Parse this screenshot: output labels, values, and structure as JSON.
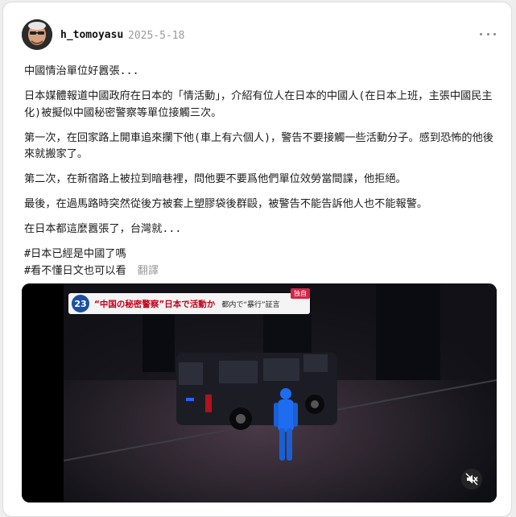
{
  "post": {
    "username": "h_tomoyasu",
    "date": "2025-5-18",
    "paragraphs": [
      "中國情治單位好囂張...",
      "日本媒體報道中國政府在日本的「情活動」，介紹有位人在日本的中國人(在日本上班，主張中國民主化)被擬似中國秘密警察等單位接觸三次。",
      "第一次，在回家路上開車追來攔下他(車上有六個人)，警告不要接觸一些活動分子。感到恐怖的他後來就搬家了。",
      "第二次，在新宿路上被拉到暗巷裡，問他要不要爲他們單位效勞當間諜，他拒絕。",
      "最後，在過馬路時突然從後方被套上塑膠袋後群毆，被警告不能告訴他人也不能報警。",
      "在日本都這麼囂張了，台灣就..."
    ],
    "tags": [
      "#日本已經是中國了嗎",
      "#看不懂日文也可以看"
    ],
    "translate_label": "翻譯"
  },
  "video": {
    "channel_number": "23",
    "headline": "“中国の秘密警察”日本で活動か",
    "subheadline": "都内で“暴行”証言",
    "exclusive_label": "独自"
  },
  "icons": {
    "more": "more-horizontal-icon",
    "mute": "volume-muted-icon"
  },
  "colors": {
    "date": "#9a9a9a",
    "ticker_red": "#c0001a",
    "channel_blue": "#1a4fa3"
  }
}
